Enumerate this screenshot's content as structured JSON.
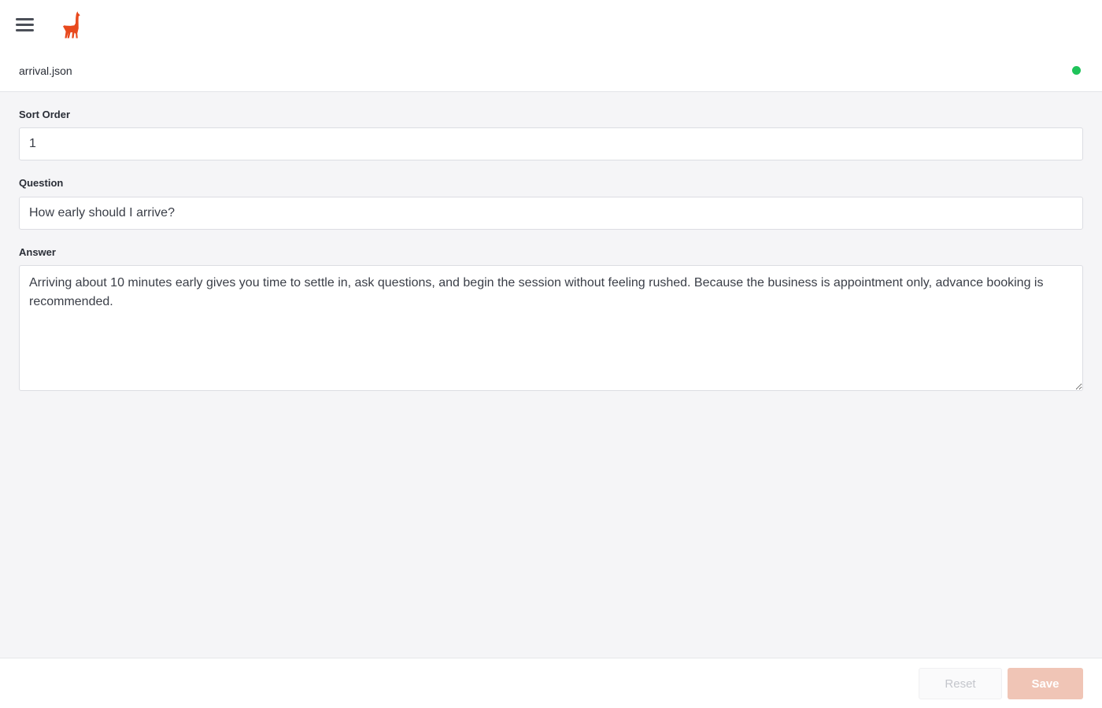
{
  "header": {
    "menu_icon": "hamburger-menu-icon",
    "logo_icon": "llama-logo-icon",
    "logo_color": "#e8491d"
  },
  "file": {
    "name": "arrival.json",
    "status_color": "#1fc35a"
  },
  "form": {
    "sort_order": {
      "label": "Sort Order",
      "value": "1"
    },
    "question": {
      "label": "Question",
      "value": "How early should I arrive?"
    },
    "answer": {
      "label": "Answer",
      "value": "Arriving about 10 minutes early gives you time to settle in, ask questions, and begin the session without feeling rushed. Because the business is appointment only, advance booking is recommended."
    }
  },
  "footer": {
    "reset_label": "Reset",
    "save_label": "Save"
  },
  "colors": {
    "accent": "#e8491d",
    "save_disabled": "#f0c5b6",
    "background": "#f5f5f7"
  }
}
